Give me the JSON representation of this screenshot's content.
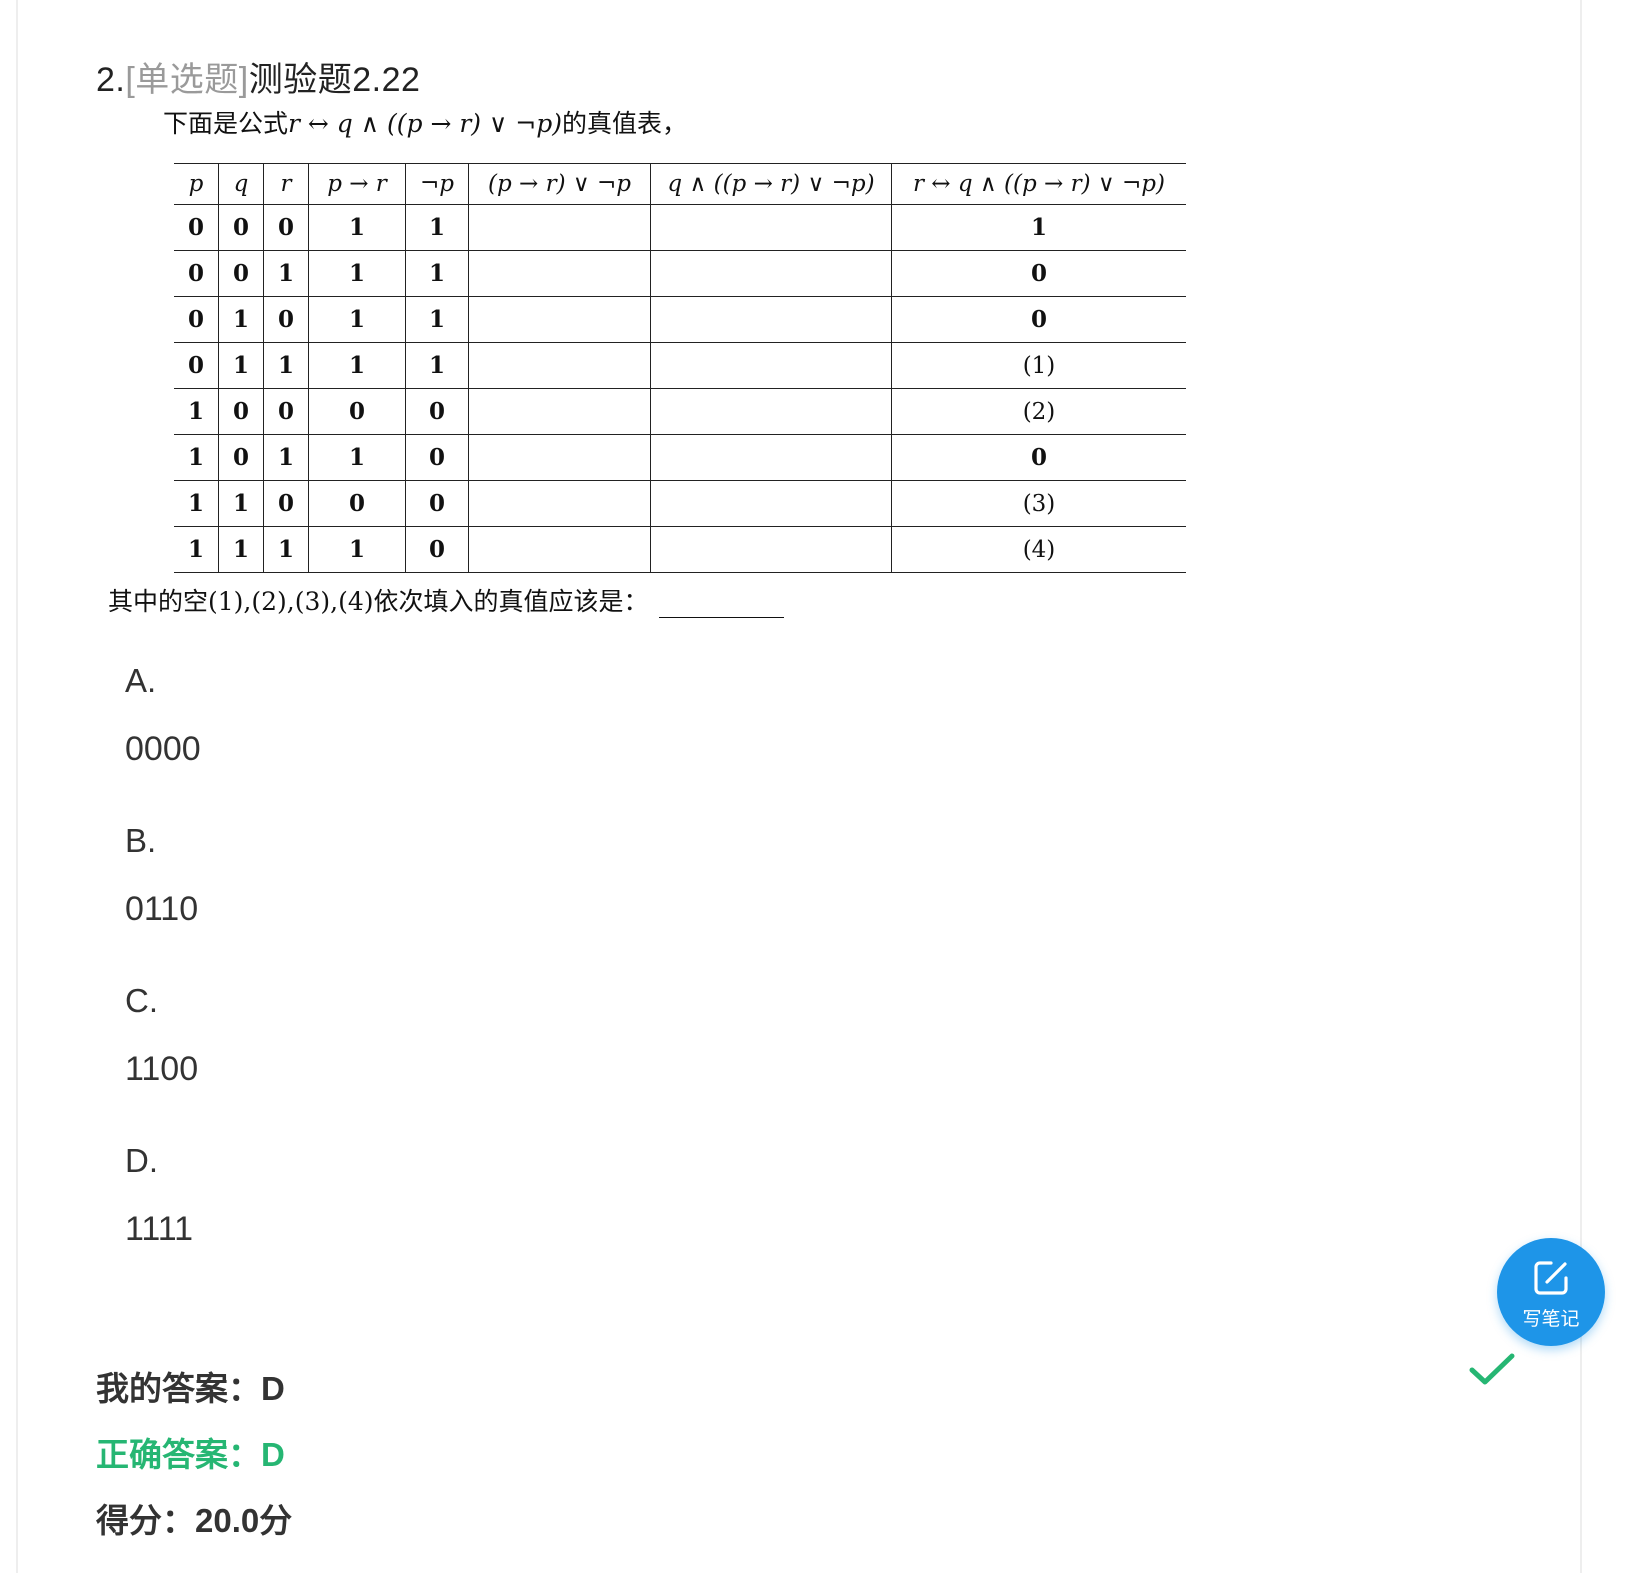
{
  "question": {
    "number": "2.",
    "type": "[单选题]",
    "title": "测验题2.22",
    "intro_prefix": "下面是公式",
    "formula": "r ↔ q ∧ ((p → r) ∨ ¬p)",
    "intro_suffix": "的真值表，",
    "fill_prompt": "其中的空(1),(2),(3),(4)依次填入的真值应该是："
  },
  "truth_table": {
    "headers": [
      "p",
      "q",
      "r",
      "p → r",
      "¬p",
      "(p → r) ∨ ¬p",
      "q ∧ ((p → r) ∨ ¬p)",
      "r ↔ q ∧ ((p → r) ∨ ¬p)"
    ],
    "rows": [
      [
        "0",
        "0",
        "0",
        "1",
        "1",
        "",
        "",
        "1"
      ],
      [
        "0",
        "0",
        "1",
        "1",
        "1",
        "",
        "",
        "0"
      ],
      [
        "0",
        "1",
        "0",
        "1",
        "1",
        "",
        "",
        "0"
      ],
      [
        "0",
        "1",
        "1",
        "1",
        "1",
        "",
        "",
        "(1)"
      ],
      [
        "1",
        "0",
        "0",
        "0",
        "0",
        "",
        "",
        "(2)"
      ],
      [
        "1",
        "0",
        "1",
        "1",
        "0",
        "",
        "",
        "0"
      ],
      [
        "1",
        "1",
        "0",
        "0",
        "0",
        "",
        "",
        "(3)"
      ],
      [
        "1",
        "1",
        "1",
        "1",
        "0",
        "",
        "",
        "(4)"
      ]
    ]
  },
  "options": [
    {
      "letter": "A.",
      "value": "0000"
    },
    {
      "letter": "B.",
      "value": "0110"
    },
    {
      "letter": "C.",
      "value": "1100"
    },
    {
      "letter": "D.",
      "value": "1111"
    }
  ],
  "result": {
    "my_answer": "我的答案：D",
    "correct_answer": "正确答案：D",
    "score": "得分：20.0分"
  },
  "note_button": {
    "label": "写笔记",
    "icon": "edit-note-icon"
  },
  "colors": {
    "correct": "#26b673",
    "note_button": "#1e95e8",
    "type_tag": "#9a9a9a"
  }
}
